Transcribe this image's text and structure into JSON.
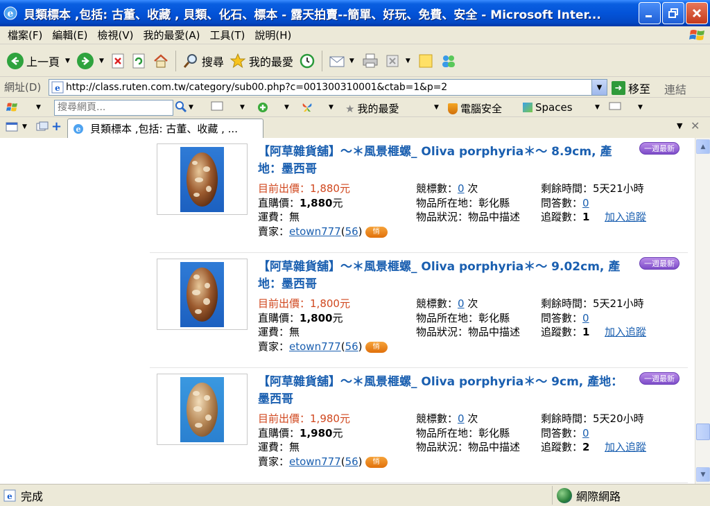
{
  "window": {
    "title": "貝類標本 ,包括: 古董、收藏 , 貝類、化石、標本 - 露天拍賣--簡單、好玩、免費、安全 - Microsoft Inter..."
  },
  "menu": [
    "檔案(F)",
    "編輯(E)",
    "檢視(V)",
    "我的最愛(A)",
    "工具(T)",
    "說明(H)"
  ],
  "toolbar": {
    "back_label": "上一頁",
    "search_label": "搜尋",
    "favorites_label": "我的最愛"
  },
  "address": {
    "label": "網址(D)",
    "url": "http://class.ruten.com.tw/category/sub00.php?c=001300310001&ctab=1&p=2",
    "go_label": "移至",
    "links_label": "連結"
  },
  "linkbar": {
    "search_placeholder": "搜尋網頁...",
    "favorites": "我的最愛",
    "security": "電腦安全",
    "spaces": "Spaces"
  },
  "tab": {
    "title": "貝類標本 ,包括: 古董、收藏 , ..."
  },
  "labels": {
    "current_bid": "目前出價：",
    "buy_now": "直購價：",
    "shipping": "運費：",
    "seller": "賣家：",
    "bids": "競標數：",
    "bids_unit": "次",
    "location": "物品所在地：",
    "condition": "物品狀況：",
    "time_left": "剩餘時間：",
    "questions": "問答數：",
    "watchers": "追蹤數：",
    "add_watch": "加入追蹤",
    "new_badge": "一週最新",
    "chat": "悄"
  },
  "items": [
    {
      "title": "【阿草雜貨舖】～＊風景榧螺_ Oliva porphyria＊～ 8.9cm, 產地：墨西哥",
      "current_price": "1,880元",
      "buy_now": "1,880",
      "buy_now_unit": "元",
      "shipping": "無",
      "seller": "etown777",
      "seller_rating": "56",
      "bids": "0",
      "location": "彰化縣",
      "condition": "物品中描述",
      "time_left": "5天21小時",
      "questions": "0",
      "watchers": "1"
    },
    {
      "title": "【阿草雜貨舖】～＊風景榧螺_ Oliva porphyria＊～ 9.02cm, 產地：墨西哥",
      "current_price": "1,800元",
      "buy_now": "1,800",
      "buy_now_unit": "元",
      "shipping": "無",
      "seller": "etown777",
      "seller_rating": "56",
      "bids": "0",
      "location": "彰化縣",
      "condition": "物品中描述",
      "time_left": "5天21小時",
      "questions": "0",
      "watchers": "1"
    },
    {
      "title": "【阿草雜貨舖】～＊風景榧螺_ Oliva porphyria＊～ 9cm, 產地：墨西哥",
      "current_price": "1,980元",
      "buy_now": "1,980",
      "buy_now_unit": "元",
      "shipping": "無",
      "seller": "etown777",
      "seller_rating": "56",
      "bids": "0",
      "location": "彰化縣",
      "condition": "物品中描述",
      "time_left": "5天20小時",
      "questions": "0",
      "watchers": "2"
    }
  ],
  "status": {
    "left": "完成",
    "zone": "網際網路"
  }
}
